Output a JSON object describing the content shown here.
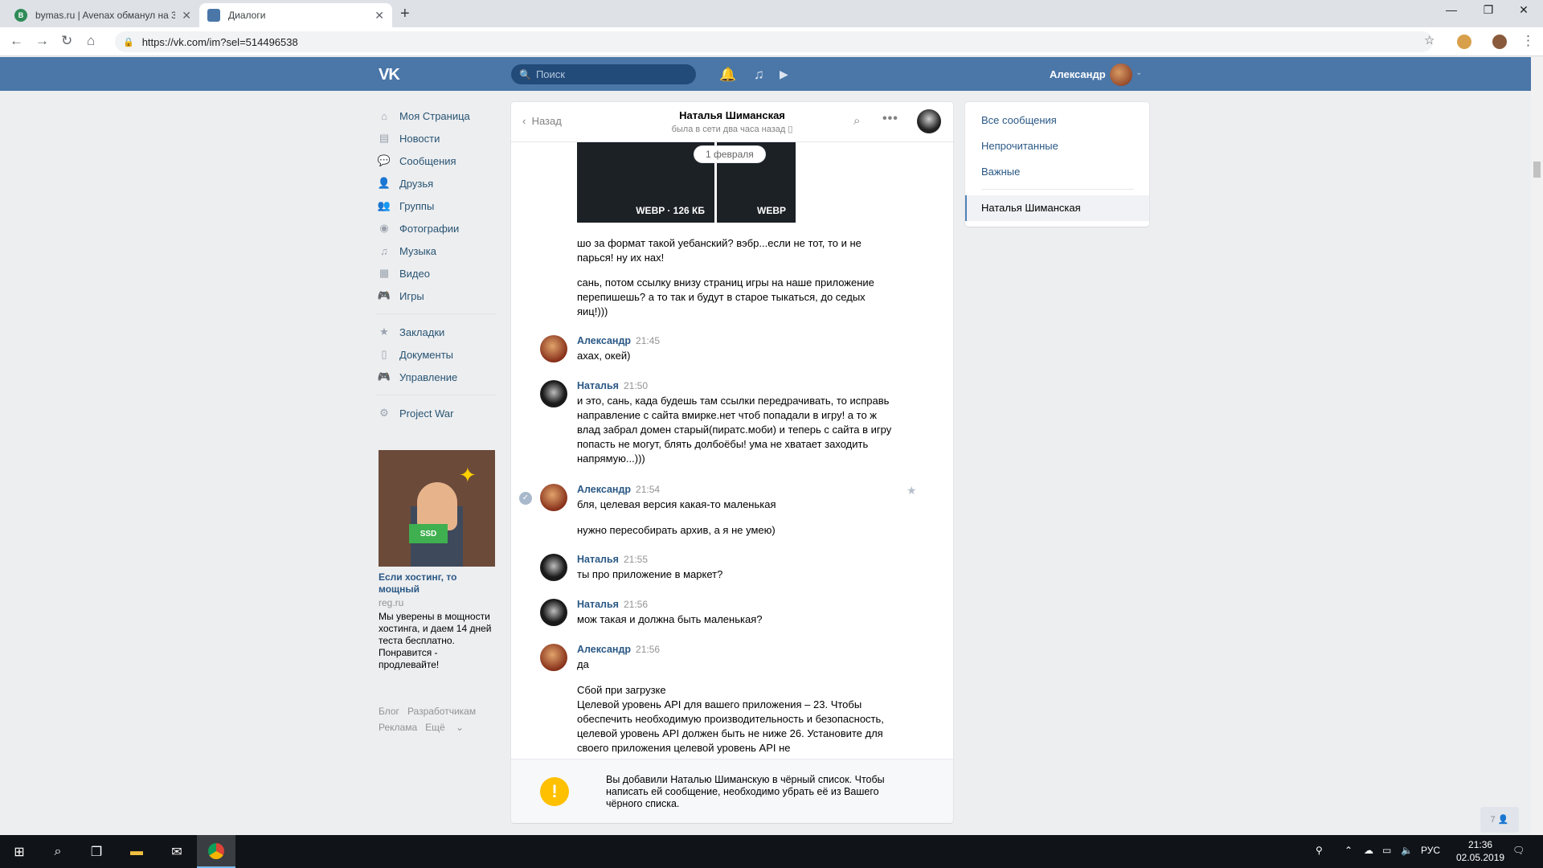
{
  "browser": {
    "tabs": [
      {
        "title": "bymas.ru | Avenax обманул на 3",
        "favicon": "B"
      },
      {
        "title": "Диалоги",
        "favicon": "vk"
      }
    ],
    "url": "https://vk.com/im?sel=514496538"
  },
  "vk": {
    "logo": "VK",
    "search_placeholder": "Поиск",
    "user_name": "Александр",
    "accent": "#4a76a8"
  },
  "left_menu": {
    "items": [
      {
        "icon": "home-icon",
        "label": "Моя Страница"
      },
      {
        "icon": "news-icon",
        "label": "Новости"
      },
      {
        "icon": "messages-icon",
        "label": "Сообщения"
      },
      {
        "icon": "friends-icon",
        "label": "Друзья"
      },
      {
        "icon": "groups-icon",
        "label": "Группы"
      },
      {
        "icon": "photos-icon",
        "label": "Фотографии"
      },
      {
        "icon": "music-icon",
        "label": "Музыка"
      },
      {
        "icon": "video-icon",
        "label": "Видео"
      },
      {
        "icon": "games-icon",
        "label": "Игры"
      }
    ],
    "items2": [
      {
        "icon": "bookmarks-icon",
        "label": "Закладки"
      },
      {
        "icon": "documents-icon",
        "label": "Документы"
      },
      {
        "icon": "manage-icon",
        "label": "Управление"
      }
    ],
    "app": {
      "icon": "app-icon",
      "label": "Project War"
    }
  },
  "ad": {
    "title": "Если хостинг, то мощный",
    "domain": "reg.ru",
    "text": "Мы уверены в мощности хостинга, и даем 14 дней теста бесплатно. Понравится - продлевайте!",
    "image_label": "SSD"
  },
  "footer": {
    "links": [
      "Блог",
      "Разработчикам",
      "Реклама",
      "Ещё"
    ]
  },
  "chat": {
    "back_label": "Назад",
    "name": "Наталья Шиманская",
    "status": "была в сети два часа назад",
    "date_plate": "1 февраля",
    "attachments": [
      {
        "label": "WEBP · 126 КБ"
      },
      {
        "label": "WEBP"
      }
    ],
    "continued_texts": [
      "шо за формат такой уебанский? вэбр...если не тот, то и не парься! ну их нах!",
      "сань, потом ссылку внизу страниц игры на наше приложение перепишешь? а то так и будут в старое тыкаться, до седых яиц!)))"
    ],
    "messages": [
      {
        "author": "Александр",
        "time": "21:45",
        "avatar": "alex",
        "lines": [
          "ахах, окей)"
        ]
      },
      {
        "author": "Наталья",
        "time": "21:50",
        "avatar": "nat",
        "lines": [
          "и это, сань, када будешь там ссылки передрачивать, то исправь направление с сайта вмирке.нет чтоб попадали в игру! а то ж влад забрал домен старый(пиратс.моби) и теперь с сайта в игру попасть не могут, блять долбоёбы! ума не хватает заходить напрямую...)))"
        ]
      },
      {
        "author": "Александр",
        "time": "21:54",
        "avatar": "alex",
        "lines": [
          "бля, целевая версия какая-то маленькая",
          "нужно пересобирать архив, а я не умею)"
        ]
      },
      {
        "author": "Наталья",
        "time": "21:55",
        "avatar": "nat",
        "lines": [
          "ты про приложение в маркет?"
        ]
      },
      {
        "author": "Наталья",
        "time": "21:56",
        "avatar": "nat",
        "lines": [
          "мож такая и должна быть маленькая?"
        ]
      },
      {
        "author": "Александр",
        "time": "21:56",
        "avatar": "alex",
        "lines": [
          "да",
          "Сбой при загрузке\nЦелевой уровень API для вашего приложения – 23. Чтобы обеспечить необходимую производительность и безопасность, целевой уровень API должен быть не ниже 26. Установите для своего приложения целевой уровень API не"
        ]
      }
    ],
    "blacklist_notice": "Вы добавили Наталью Шиманскую в чёрный список. Чтобы написать ей сообщение, необходимо убрать её из Вашего чёрного списка."
  },
  "right_menu": {
    "items": [
      "Все сообщения",
      "Непрочитанные",
      "Важные"
    ],
    "active": "Наталья Шиманская"
  },
  "online_count": "7",
  "taskbar": {
    "lang": "РУС",
    "time": "21:36",
    "date": "02.05.2019"
  }
}
